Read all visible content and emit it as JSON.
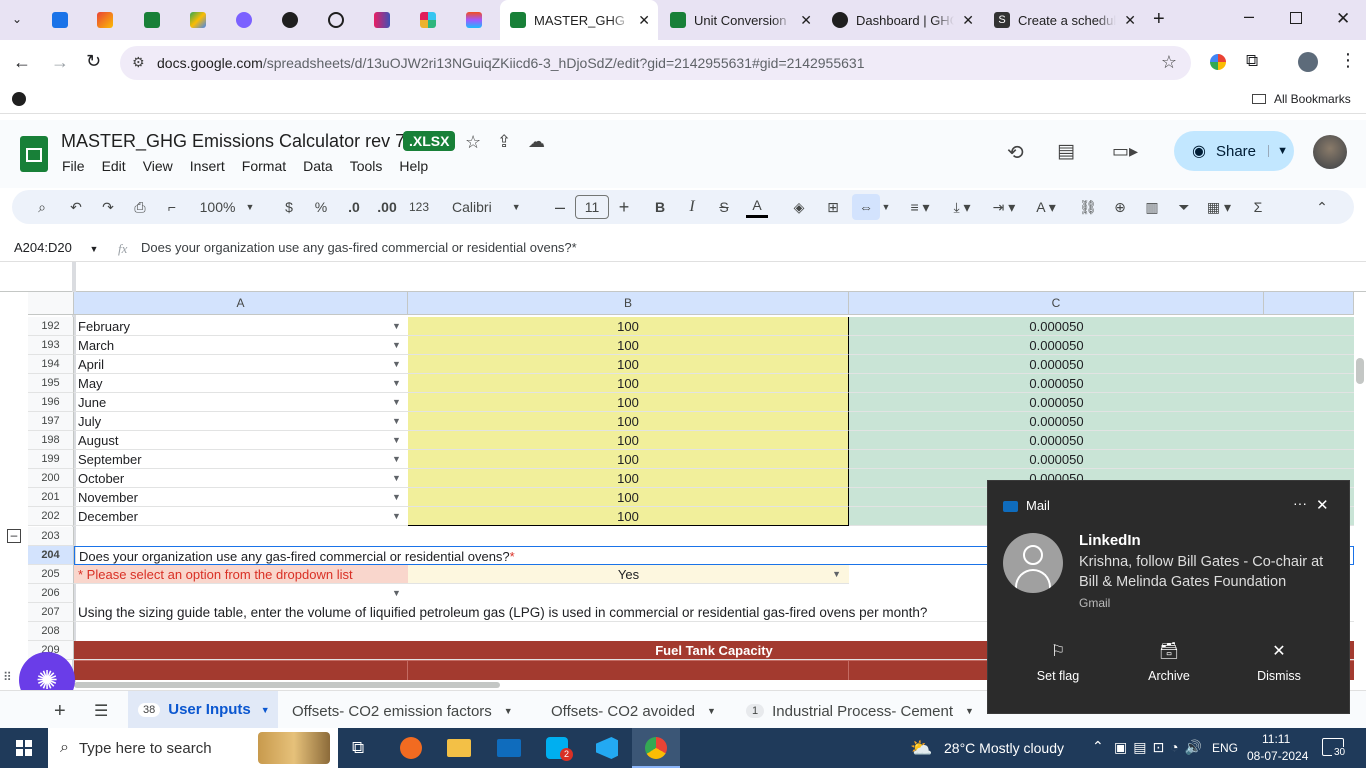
{
  "browser": {
    "tabs": [
      {
        "title": "MASTER_GHG Em",
        "active": true,
        "favicon": "sheets-icon"
      },
      {
        "title": "Unit Conversion",
        "active": false,
        "favicon": "sheets-icon"
      },
      {
        "title": "Dashboard | GHG",
        "active": false,
        "favicon": "dashboard-icon"
      },
      {
        "title": "Create a schedule",
        "active": false,
        "favicon": "s-icon"
      }
    ],
    "url_host": "docs.google.com",
    "url_path": "/spreadsheets/d/13uOJW2ri13NGuiqZKiicd6-3_hDjoSdZ/edit?gid=2142955631#gid=2142955631",
    "bookmarks_label": "All Bookmarks"
  },
  "doc": {
    "title": "MASTER_GHG Emissions Calculator rev 7",
    "badge": ".XLSX",
    "menus": [
      "File",
      "Edit",
      "View",
      "Insert",
      "Format",
      "Data",
      "Tools",
      "Help"
    ],
    "share_label": "Share"
  },
  "toolbar": {
    "zoom": "100%",
    "currency": "$",
    "percent": "%",
    "dec_less": ".0",
    "dec_more": ".00",
    "format_123": "123",
    "font": "Calibri",
    "font_size": "11"
  },
  "formula": {
    "name_box": "A204:D20",
    "fx": "fx",
    "content": "Does your organization use any gas-fired commercial or residential ovens?*"
  },
  "columns": [
    "A",
    "B",
    "C"
  ],
  "rows": [
    {
      "num": "192",
      "a": "February",
      "b": "100",
      "c": "0.000050"
    },
    {
      "num": "193",
      "a": "March",
      "b": "100",
      "c": "0.000050"
    },
    {
      "num": "194",
      "a": "April",
      "b": "100",
      "c": "0.000050"
    },
    {
      "num": "195",
      "a": "May",
      "b": "100",
      "c": "0.000050"
    },
    {
      "num": "196",
      "a": "June",
      "b": "100",
      "c": "0.000050"
    },
    {
      "num": "197",
      "a": "July",
      "b": "100",
      "c": "0.000050"
    },
    {
      "num": "198",
      "a": "August",
      "b": "100",
      "c": "0.000050"
    },
    {
      "num": "199",
      "a": "September",
      "b": "100",
      "c": "0.000050"
    },
    {
      "num": "200",
      "a": "October",
      "b": "100",
      "c": "0.000050"
    },
    {
      "num": "201",
      "a": "November",
      "b": "100",
      "c": ""
    },
    {
      "num": "202",
      "a": "December",
      "b": "100",
      "c": ""
    }
  ],
  "extra_rows": {
    "r203": "203",
    "r204": "204",
    "r204_text": "Does your organization use any gas-fired commercial or residential ovens?",
    "r204_star": "*",
    "r205": "205",
    "r205_text": "* Please select an option from the dropdown list",
    "r205_value": "Yes",
    "r206": "206",
    "r207": "207",
    "r207_text": "Using the sizing guide table, enter the volume of liquified petroleum gas (LPG) is used in commercial or residential gas-fired ovens per month?",
    "r208": "208",
    "r209": "209",
    "r209_text": "Fuel Tank Capacity"
  },
  "sheet_tabs": [
    {
      "badge": "38",
      "label": "User Inputs",
      "active": true
    },
    {
      "badge": "",
      "label": "Offsets-  CO2 emission factors",
      "active": false
    },
    {
      "badge": "",
      "label": "Offsets- CO2 avoided",
      "active": false
    },
    {
      "badge": "1",
      "label": "Industrial Process- Cement",
      "active": false
    }
  ],
  "toast": {
    "app": "Mail",
    "sender": "LinkedIn",
    "message": "Krishna, follow Bill Gates - Co-chair at Bill & Melinda Gates Foundation",
    "source": "Gmail",
    "actions": [
      "Set flag",
      "Archive",
      "Dismiss"
    ]
  },
  "taskbar": {
    "search_placeholder": "Type here to search",
    "weather": "28°C  Mostly cloudy",
    "lang": "ENG",
    "time": "11:11",
    "date": "08-07-2024",
    "notif_count": "30",
    "skype_badge": "2"
  },
  "colors": {
    "yellow_cell": "#f1ef9b",
    "green_cell": "#c9e4d6",
    "red_band": "#a33a2f",
    "pink_cell": "#f9d6cc"
  }
}
